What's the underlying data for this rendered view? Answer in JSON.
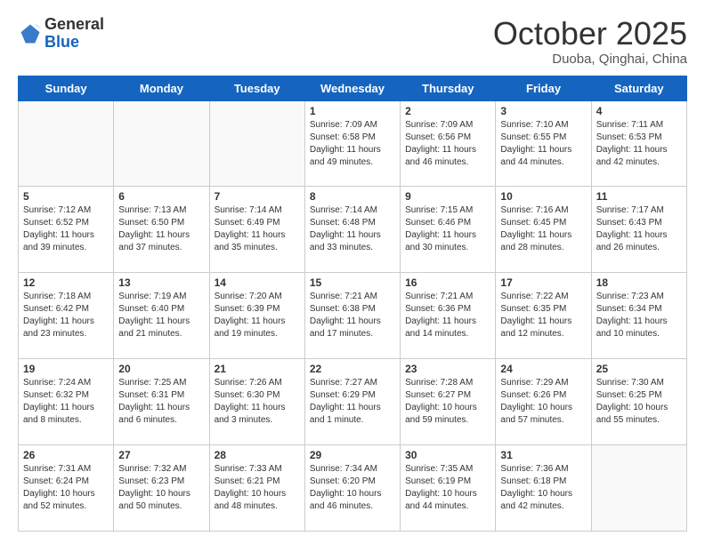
{
  "header": {
    "logo_general": "General",
    "logo_blue": "Blue",
    "month_title": "October 2025",
    "location": "Duoba, Qinghai, China"
  },
  "weekdays": [
    "Sunday",
    "Monday",
    "Tuesday",
    "Wednesday",
    "Thursday",
    "Friday",
    "Saturday"
  ],
  "weeks": [
    [
      {
        "day": "",
        "info": ""
      },
      {
        "day": "",
        "info": ""
      },
      {
        "day": "",
        "info": ""
      },
      {
        "day": "1",
        "info": "Sunrise: 7:09 AM\nSunset: 6:58 PM\nDaylight: 11 hours\nand 49 minutes."
      },
      {
        "day": "2",
        "info": "Sunrise: 7:09 AM\nSunset: 6:56 PM\nDaylight: 11 hours\nand 46 minutes."
      },
      {
        "day": "3",
        "info": "Sunrise: 7:10 AM\nSunset: 6:55 PM\nDaylight: 11 hours\nand 44 minutes."
      },
      {
        "day": "4",
        "info": "Sunrise: 7:11 AM\nSunset: 6:53 PM\nDaylight: 11 hours\nand 42 minutes."
      }
    ],
    [
      {
        "day": "5",
        "info": "Sunrise: 7:12 AM\nSunset: 6:52 PM\nDaylight: 11 hours\nand 39 minutes."
      },
      {
        "day": "6",
        "info": "Sunrise: 7:13 AM\nSunset: 6:50 PM\nDaylight: 11 hours\nand 37 minutes."
      },
      {
        "day": "7",
        "info": "Sunrise: 7:14 AM\nSunset: 6:49 PM\nDaylight: 11 hours\nand 35 minutes."
      },
      {
        "day": "8",
        "info": "Sunrise: 7:14 AM\nSunset: 6:48 PM\nDaylight: 11 hours\nand 33 minutes."
      },
      {
        "day": "9",
        "info": "Sunrise: 7:15 AM\nSunset: 6:46 PM\nDaylight: 11 hours\nand 30 minutes."
      },
      {
        "day": "10",
        "info": "Sunrise: 7:16 AM\nSunset: 6:45 PM\nDaylight: 11 hours\nand 28 minutes."
      },
      {
        "day": "11",
        "info": "Sunrise: 7:17 AM\nSunset: 6:43 PM\nDaylight: 11 hours\nand 26 minutes."
      }
    ],
    [
      {
        "day": "12",
        "info": "Sunrise: 7:18 AM\nSunset: 6:42 PM\nDaylight: 11 hours\nand 23 minutes."
      },
      {
        "day": "13",
        "info": "Sunrise: 7:19 AM\nSunset: 6:40 PM\nDaylight: 11 hours\nand 21 minutes."
      },
      {
        "day": "14",
        "info": "Sunrise: 7:20 AM\nSunset: 6:39 PM\nDaylight: 11 hours\nand 19 minutes."
      },
      {
        "day": "15",
        "info": "Sunrise: 7:21 AM\nSunset: 6:38 PM\nDaylight: 11 hours\nand 17 minutes."
      },
      {
        "day": "16",
        "info": "Sunrise: 7:21 AM\nSunset: 6:36 PM\nDaylight: 11 hours\nand 14 minutes."
      },
      {
        "day": "17",
        "info": "Sunrise: 7:22 AM\nSunset: 6:35 PM\nDaylight: 11 hours\nand 12 minutes."
      },
      {
        "day": "18",
        "info": "Sunrise: 7:23 AM\nSunset: 6:34 PM\nDaylight: 11 hours\nand 10 minutes."
      }
    ],
    [
      {
        "day": "19",
        "info": "Sunrise: 7:24 AM\nSunset: 6:32 PM\nDaylight: 11 hours\nand 8 minutes."
      },
      {
        "day": "20",
        "info": "Sunrise: 7:25 AM\nSunset: 6:31 PM\nDaylight: 11 hours\nand 6 minutes."
      },
      {
        "day": "21",
        "info": "Sunrise: 7:26 AM\nSunset: 6:30 PM\nDaylight: 11 hours\nand 3 minutes."
      },
      {
        "day": "22",
        "info": "Sunrise: 7:27 AM\nSunset: 6:29 PM\nDaylight: 11 hours\nand 1 minute."
      },
      {
        "day": "23",
        "info": "Sunrise: 7:28 AM\nSunset: 6:27 PM\nDaylight: 10 hours\nand 59 minutes."
      },
      {
        "day": "24",
        "info": "Sunrise: 7:29 AM\nSunset: 6:26 PM\nDaylight: 10 hours\nand 57 minutes."
      },
      {
        "day": "25",
        "info": "Sunrise: 7:30 AM\nSunset: 6:25 PM\nDaylight: 10 hours\nand 55 minutes."
      }
    ],
    [
      {
        "day": "26",
        "info": "Sunrise: 7:31 AM\nSunset: 6:24 PM\nDaylight: 10 hours\nand 52 minutes."
      },
      {
        "day": "27",
        "info": "Sunrise: 7:32 AM\nSunset: 6:23 PM\nDaylight: 10 hours\nand 50 minutes."
      },
      {
        "day": "28",
        "info": "Sunrise: 7:33 AM\nSunset: 6:21 PM\nDaylight: 10 hours\nand 48 minutes."
      },
      {
        "day": "29",
        "info": "Sunrise: 7:34 AM\nSunset: 6:20 PM\nDaylight: 10 hours\nand 46 minutes."
      },
      {
        "day": "30",
        "info": "Sunrise: 7:35 AM\nSunset: 6:19 PM\nDaylight: 10 hours\nand 44 minutes."
      },
      {
        "day": "31",
        "info": "Sunrise: 7:36 AM\nSunset: 6:18 PM\nDaylight: 10 hours\nand 42 minutes."
      },
      {
        "day": "",
        "info": ""
      }
    ]
  ]
}
